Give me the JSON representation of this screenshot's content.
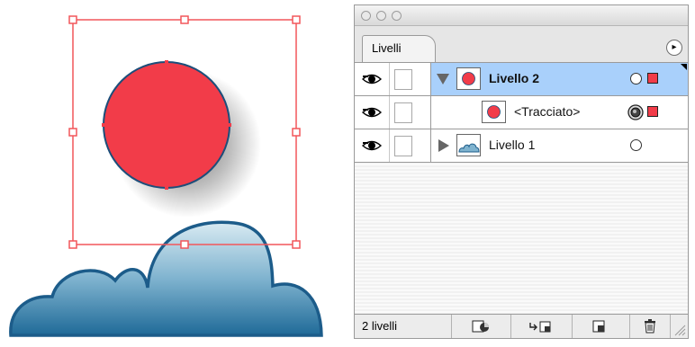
{
  "panel": {
    "tab_label": "Livelli",
    "menu_button": "▸",
    "layers": [
      {
        "name": "Livello 2",
        "expanded": true,
        "selected": true,
        "thumb": "red-circle"
      },
      {
        "name": "<Tracciato>",
        "expanded": false,
        "selected": false,
        "thumb": "red-circle"
      },
      {
        "name": "Livello 1",
        "expanded": false,
        "selected": false,
        "thumb": "cloud"
      }
    ],
    "status_text": "2 livelli",
    "buttons": [
      "make-clipping-mask-icon",
      "new-sublayer-icon",
      "new-layer-icon",
      "trash-icon"
    ]
  },
  "colors": {
    "circle_fill": "#f23c49",
    "selection_frame": "#f2565a",
    "cloud_stroke": "#1c5c8a",
    "selected_row": "#a9d0fb"
  }
}
